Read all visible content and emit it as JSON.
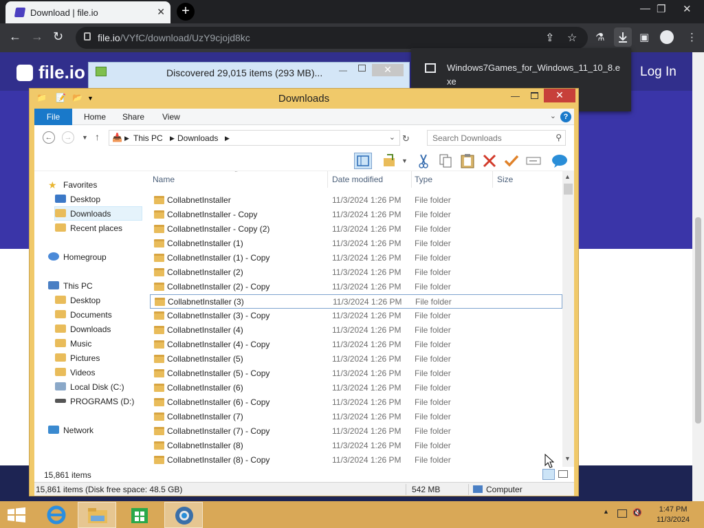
{
  "browser": {
    "tab_title": "Download | file.io",
    "tab_close": "✕",
    "new_tab": "+",
    "url_host": "file.io",
    "url_path": "/VYfC/download/UzY9cjojd8kc"
  },
  "webpage": {
    "logo_text": "file.io",
    "login_label": "Log In"
  },
  "download_popup": {
    "file_name": "Windows7Games_for_Windows_11_10_8.exe"
  },
  "copy_dialog": {
    "title": "Discovered 29,015 items (293 MB)..."
  },
  "explorer": {
    "title": "Downloads",
    "ribbon_tabs": [
      "File",
      "Home",
      "Share",
      "View"
    ],
    "breadcrumb": [
      "This PC",
      "Downloads"
    ],
    "search_placeholder": "Search Downloads",
    "columns": [
      "Name",
      "Date modified",
      "Type",
      "Size"
    ],
    "nav": {
      "favorites": "Favorites",
      "fav_items": [
        "Desktop",
        "Downloads",
        "Recent places"
      ],
      "homegroup": "Homegroup",
      "this_pc": "This PC",
      "pc_items": [
        "Desktop",
        "Documents",
        "Downloads",
        "Music",
        "Pictures",
        "Videos",
        "Local Disk (C:)",
        "PROGRAMS (D:)"
      ],
      "network": "Network"
    },
    "files": [
      {
        "name": "CollabnetInstaller",
        "date": "11/3/2024 1:26 PM",
        "type": "File folder"
      },
      {
        "name": "CollabnetInstaller - Copy",
        "date": "11/3/2024 1:26 PM",
        "type": "File folder"
      },
      {
        "name": "CollabnetInstaller - Copy (2)",
        "date": "11/3/2024 1:26 PM",
        "type": "File folder"
      },
      {
        "name": "CollabnetInstaller (1)",
        "date": "11/3/2024 1:26 PM",
        "type": "File folder"
      },
      {
        "name": "CollabnetInstaller (1) - Copy",
        "date": "11/3/2024 1:26 PM",
        "type": "File folder"
      },
      {
        "name": "CollabnetInstaller (2)",
        "date": "11/3/2024 1:26 PM",
        "type": "File folder"
      },
      {
        "name": "CollabnetInstaller (2) - Copy",
        "date": "11/3/2024 1:26 PM",
        "type": "File folder"
      },
      {
        "name": "CollabnetInstaller (3)",
        "date": "11/3/2024 1:26 PM",
        "type": "File folder"
      },
      {
        "name": "CollabnetInstaller (3) - Copy",
        "date": "11/3/2024 1:26 PM",
        "type": "File folder"
      },
      {
        "name": "CollabnetInstaller (4)",
        "date": "11/3/2024 1:26 PM",
        "type": "File folder"
      },
      {
        "name": "CollabnetInstaller (4) - Copy",
        "date": "11/3/2024 1:26 PM",
        "type": "File folder"
      },
      {
        "name": "CollabnetInstaller (5)",
        "date": "11/3/2024 1:26 PM",
        "type": "File folder"
      },
      {
        "name": "CollabnetInstaller (5) - Copy",
        "date": "11/3/2024 1:26 PM",
        "type": "File folder"
      },
      {
        "name": "CollabnetInstaller (6)",
        "date": "11/3/2024 1:26 PM",
        "type": "File folder"
      },
      {
        "name": "CollabnetInstaller (6) - Copy",
        "date": "11/3/2024 1:26 PM",
        "type": "File folder"
      },
      {
        "name": "CollabnetInstaller (7)",
        "date": "11/3/2024 1:26 PM",
        "type": "File folder"
      },
      {
        "name": "CollabnetInstaller (7) - Copy",
        "date": "11/3/2024 1:26 PM",
        "type": "File folder"
      },
      {
        "name": "CollabnetInstaller (8)",
        "date": "11/3/2024 1:26 PM",
        "type": "File folder"
      },
      {
        "name": "CollabnetInstaller (8) - Copy",
        "date": "11/3/2024 1:26 PM",
        "type": "File folder"
      }
    ],
    "selected_index": 7,
    "item_count": "15,861 items",
    "status_items": "15,861 items (Disk free space: 48.5 GB)",
    "status_size": "542 MB",
    "status_location": "Computer"
  },
  "taskbar": {
    "time": "1:47 PM",
    "date": "11/3/2024"
  },
  "colors": {
    "explorer_frame": "#f0c96a",
    "file_tab": "#1979ca",
    "close_red": "#c7403a",
    "page_purple": "#3a35a8",
    "taskbar": "#d9a857"
  }
}
